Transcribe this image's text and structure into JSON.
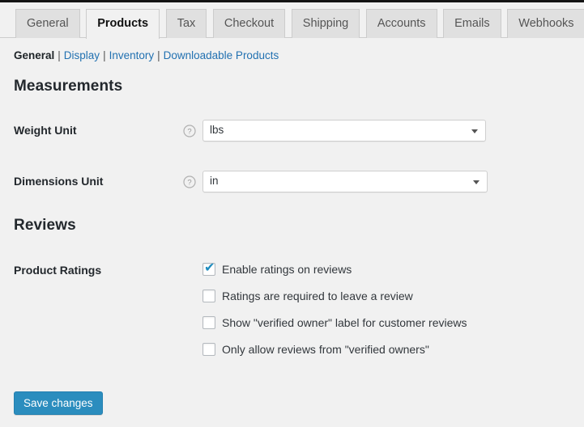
{
  "colors": {
    "page_background": "#f1f1f1",
    "accent_blue": "#2b8dbe",
    "link_blue": "#2271b1",
    "checkmark_blue": "#1e8cbe",
    "tab_inactive": "#e0e0e0",
    "border_gray": "#cccccc",
    "admin_strip": "#141414"
  },
  "tabs": [
    {
      "label": "General",
      "active": false
    },
    {
      "label": "Products",
      "active": true
    },
    {
      "label": "Tax",
      "active": false
    },
    {
      "label": "Checkout",
      "active": false
    },
    {
      "label": "Shipping",
      "active": false
    },
    {
      "label": "Accounts",
      "active": false
    },
    {
      "label": "Emails",
      "active": false
    },
    {
      "label": "Webhooks",
      "active": false
    }
  ],
  "subnav": {
    "separator": "|",
    "items": [
      {
        "label": "General",
        "current": true
      },
      {
        "label": "Display",
        "current": false
      },
      {
        "label": "Inventory",
        "current": false
      },
      {
        "label": "Downloadable Products",
        "current": false
      }
    ]
  },
  "sections": {
    "measurements": {
      "heading": "Measurements",
      "weight_unit": {
        "label": "Weight Unit",
        "help_icon": "help-circle-icon",
        "value": "lbs",
        "dropdown_icon": "chevron-down-icon"
      },
      "dimensions_unit": {
        "label": "Dimensions Unit",
        "help_icon": "help-circle-icon",
        "value": "in",
        "dropdown_icon": "chevron-down-icon"
      }
    },
    "reviews": {
      "heading": "Reviews",
      "product_ratings": {
        "label": "Product Ratings",
        "options": [
          {
            "label": "Enable ratings on reviews",
            "checked": true,
            "mark": "✔"
          },
          {
            "label": "Ratings are required to leave a review",
            "checked": false,
            "mark": ""
          },
          {
            "label": "Show \"verified owner\" label for customer reviews",
            "checked": false,
            "mark": ""
          },
          {
            "label": "Only allow reviews from \"verified owners\"",
            "checked": false,
            "mark": ""
          }
        ]
      }
    }
  },
  "actions": {
    "save_label": "Save changes"
  }
}
